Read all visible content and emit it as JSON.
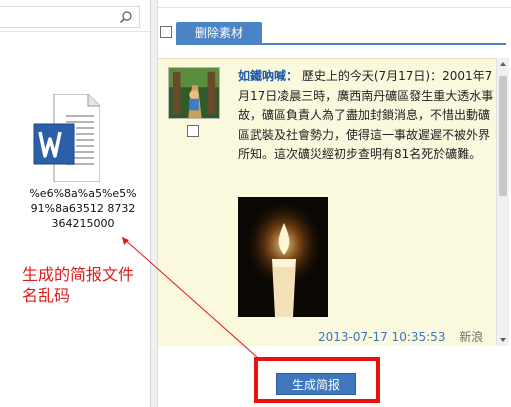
{
  "explorer": {
    "search": {
      "placeholder": ""
    },
    "file": {
      "icon": "word-document-icon",
      "name": "%e6%8a%a5%e5%91%8a63512 8732364215000"
    }
  },
  "annotation": {
    "text": "生成的简报文件名乱码",
    "color": "#e01b1b"
  },
  "panel": {
    "delete_label": "删除素材",
    "post": {
      "author": "如鐵吶喊：",
      "content": "歷史上的今天(7月17日)：2001年7月17日凌晨三時，廣西南丹礦區發生重大透水事故，礦區負責人為了盡加封鎖消息，不惜出動礦區武裝及社會勢力，使得這一事故遲遲不被外界所知。這次礦災經初步查明有81名死於礦難。",
      "date": "2013-07-17 10:35:53",
      "source": "新浪"
    },
    "generate_label": "生成简报"
  },
  "colors": {
    "accent_blue": "#4a84c5",
    "post_background": "#faf8dd",
    "highlight_red": "#e81111"
  }
}
